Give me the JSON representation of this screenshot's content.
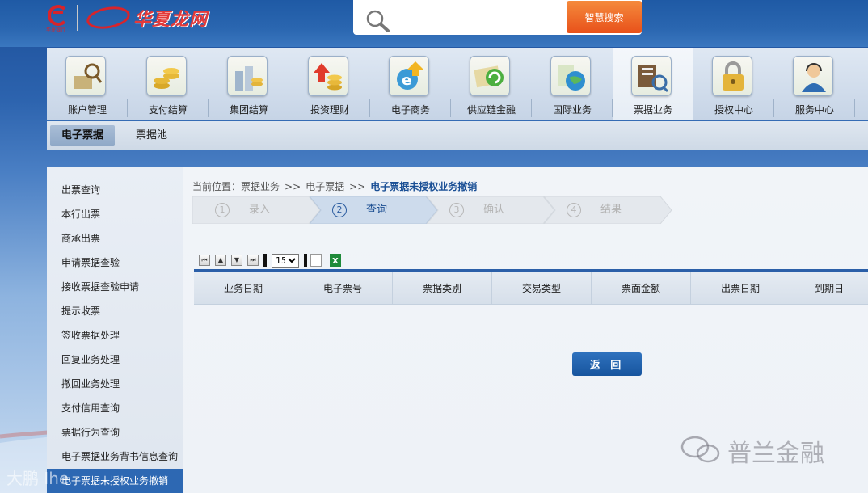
{
  "header": {
    "logo_small_text": "华夏银行",
    "logo_text": "华夏龙网",
    "search": {
      "placeholder": "",
      "button_label": "智慧搜索"
    }
  },
  "main_nav": [
    {
      "label": "账户管理",
      "icon": "account-icon",
      "active": false
    },
    {
      "label": "支付结算",
      "icon": "coins-icon",
      "active": false
    },
    {
      "label": "集团结算",
      "icon": "group-icon",
      "active": false
    },
    {
      "label": "投资理财",
      "icon": "investment-icon",
      "active": false
    },
    {
      "label": "电子商务",
      "icon": "ecommerce-icon",
      "active": false
    },
    {
      "label": "供应链金融",
      "icon": "supply-chain-icon",
      "active": false
    },
    {
      "label": "国际业务",
      "icon": "globe-icon",
      "active": false
    },
    {
      "label": "票据业务",
      "icon": "bill-icon",
      "active": true
    },
    {
      "label": "授权中心",
      "icon": "lock-icon",
      "active": false
    },
    {
      "label": "服务中心",
      "icon": "service-icon",
      "active": false
    }
  ],
  "sub_tabs": [
    {
      "label": "电子票据",
      "active": true
    },
    {
      "label": "票据池",
      "active": false
    }
  ],
  "sidebar": {
    "items": [
      {
        "label": "出票查询"
      },
      {
        "label": "本行出票"
      },
      {
        "label": "商承出票"
      },
      {
        "label": "申请票据查验"
      },
      {
        "label": "接收票据查验申请"
      },
      {
        "label": "提示收票"
      },
      {
        "label": "签收票据处理"
      },
      {
        "label": "回复业务处理"
      },
      {
        "label": "撤回业务处理"
      },
      {
        "label": "支付信用查询"
      },
      {
        "label": "票据行为查询"
      },
      {
        "label": "电子票据业务背书信息查询"
      },
      {
        "label": "电子票据未授权业务撤销"
      }
    ],
    "active_index": 12
  },
  "breadcrumb": {
    "prefix": "当前位置：",
    "items": [
      "票据业务",
      "电子票据"
    ],
    "separator": ">>",
    "current": "电子票据未授权业务撤销"
  },
  "steps": [
    {
      "num": "1",
      "label": "录入",
      "active": false
    },
    {
      "num": "2",
      "label": "查询",
      "active": true
    },
    {
      "num": "3",
      "label": "确认",
      "active": false
    },
    {
      "num": "4",
      "label": "结果",
      "active": false
    }
  ],
  "toolbar": {
    "page_size": "15"
  },
  "table": {
    "columns": [
      "业务日期",
      "电子票号",
      "票据类别",
      "交易类型",
      "票面金额",
      "出票日期",
      "到期日"
    ],
    "rows": []
  },
  "actions": {
    "back_label": "返 回"
  },
  "watermarks": {
    "left": "大鹏 Ihe",
    "right": "普兰金融"
  },
  "colors": {
    "accent": "#2b5fa8",
    "search_button": "#e8511a",
    "brand_red": "#d8242b"
  }
}
